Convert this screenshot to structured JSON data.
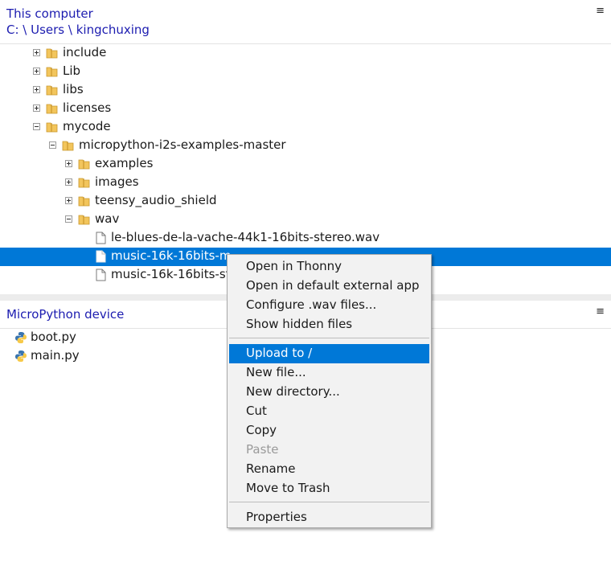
{
  "this_computer": {
    "title": "This computer",
    "path": "C: \\ Users \\ kingchuxing",
    "menu_glyph": "≡",
    "tree": [
      {
        "label": "include",
        "type": "folder",
        "expanded": false
      },
      {
        "label": "Lib",
        "type": "folder",
        "expanded": false
      },
      {
        "label": "libs",
        "type": "folder",
        "expanded": false
      },
      {
        "label": "licenses",
        "type": "folder",
        "expanded": false
      },
      {
        "label": "mycode",
        "type": "folder",
        "expanded": true
      },
      {
        "label": "micropython-i2s-examples-master",
        "type": "folder",
        "expanded": true
      },
      {
        "label": "examples",
        "type": "folder",
        "expanded": false
      },
      {
        "label": "images",
        "type": "folder",
        "expanded": false
      },
      {
        "label": "teensy_audio_shield",
        "type": "folder",
        "expanded": false
      },
      {
        "label": "wav",
        "type": "folder",
        "expanded": true
      },
      {
        "label": "le-blues-de-la-vache-44k1-16bits-stereo.wav",
        "type": "file"
      },
      {
        "label": "music-16k-16bits-m",
        "type": "file",
        "selected": true
      },
      {
        "label": "music-16k-16bits-st",
        "type": "file"
      }
    ]
  },
  "device": {
    "title": "MicroPython device",
    "menu_glyph": "≡",
    "files": [
      {
        "label": "boot.py",
        "icon": "python-icon"
      },
      {
        "label": "main.py",
        "icon": "python-icon"
      }
    ]
  },
  "context_menu": {
    "items": [
      {
        "label": "Open in Thonny"
      },
      {
        "label": "Open in default external app"
      },
      {
        "label": "Configure .wav files..."
      },
      {
        "label": "Show hidden files"
      },
      {
        "label": "Upload to /",
        "highlighted": true
      },
      {
        "label": "New file..."
      },
      {
        "label": "New directory..."
      },
      {
        "label": "Cut"
      },
      {
        "label": "Copy"
      },
      {
        "label": "Paste",
        "disabled": true
      },
      {
        "label": "Rename"
      },
      {
        "label": "Move to Trash"
      },
      {
        "label": "Properties"
      }
    ]
  },
  "colors": {
    "accent": "#0078d7",
    "header_text": "#1c1cb0",
    "folder": "#f2c55c"
  }
}
